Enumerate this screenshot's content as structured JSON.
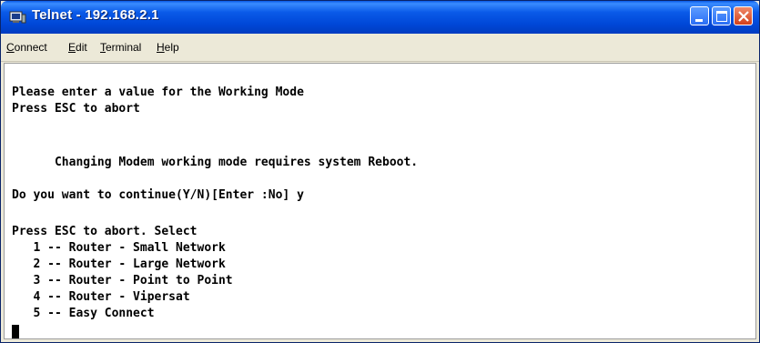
{
  "window": {
    "title": "Telnet - 192.168.2.1"
  },
  "menu": {
    "items": [
      {
        "label": "Connect",
        "mnemonic": "C",
        "rest": "onnect"
      },
      {
        "label": "Edit",
        "mnemonic": "E",
        "rest": "dit"
      },
      {
        "label": "Terminal",
        "mnemonic": "T",
        "rest": "erminal"
      },
      {
        "label": "Help",
        "mnemonic": "H",
        "rest": "elp"
      }
    ]
  },
  "terminal": {
    "lines": [
      "Please enter a value for the Working Mode",
      "Press ESC to abort",
      "      Changing Modem working mode requires system Reboot.",
      "Do you want to continue(Y/N)[Enter :No] y",
      "Press ESC to abort. Select",
      "   1 -- Router - Small Network",
      "   2 -- Router - Large Network",
      "   3 -- Router - Point to Point",
      "   4 -- Router - Vipersat",
      "   5 -- Easy Connect"
    ]
  },
  "colors": {
    "titlebar": "#0a5ae8",
    "close_button": "#d2401c",
    "terminal_bg": "#ffffff",
    "terminal_text": "#000000"
  }
}
